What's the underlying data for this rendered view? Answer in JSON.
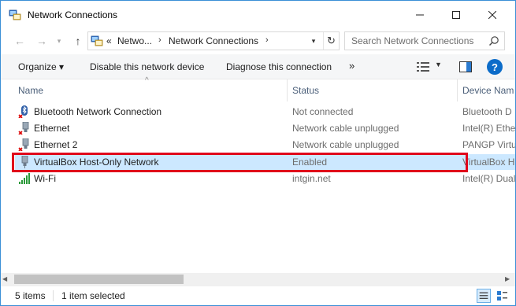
{
  "window": {
    "title": "Network Connections",
    "controls": {
      "minimize": "—",
      "maximize": "☐",
      "close": "✕"
    }
  },
  "address": {
    "prefix": "«",
    "crumbs": [
      "Netwo...",
      "Network Connections"
    ],
    "separator": "›"
  },
  "search": {
    "placeholder": "Search Network Connections"
  },
  "toolbar": {
    "organize": "Organize ▾",
    "disable": "Disable this network device",
    "diagnose": "Diagnose this connection",
    "more": "»"
  },
  "columns": {
    "name": "Name",
    "status": "Status",
    "device": "Device Nam"
  },
  "rows": [
    {
      "name": "Bluetooth Network Connection",
      "status": "Not connected",
      "device": "Bluetooth D",
      "icon": "bluetooth-icon",
      "disconnected": true,
      "selected": false
    },
    {
      "name": "Ethernet",
      "status": "Network cable unplugged",
      "device": "Intel(R) Ethe",
      "icon": "ethernet-icon",
      "disconnected": true,
      "selected": false
    },
    {
      "name": "Ethernet 2",
      "status": "Network cable unplugged",
      "device": "PANGP Virtu",
      "icon": "ethernet-icon",
      "disconnected": true,
      "selected": false
    },
    {
      "name": "VirtualBox Host-Only Network",
      "status": "Enabled",
      "device": "VirtualBox H",
      "icon": "ethernet-icon",
      "disconnected": false,
      "selected": true
    },
    {
      "name": "Wi-Fi",
      "status": "intgin.net",
      "device": "Intel(R) Dual",
      "icon": "wifi-icon",
      "disconnected": false,
      "selected": false
    }
  ],
  "statusbar": {
    "items": "5 items",
    "selection": "1 item selected"
  },
  "colors": {
    "selection": "#cce8ff",
    "highlight": "#e0001b",
    "accent": "#0c6cc9"
  }
}
